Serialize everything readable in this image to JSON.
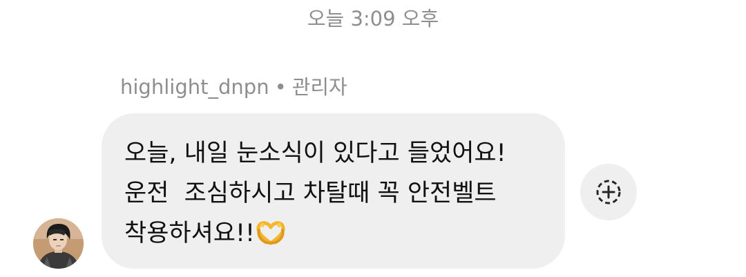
{
  "timestamp": "오늘 3:09 오후",
  "sender": {
    "username": "highlight_dnpn",
    "separator": "•",
    "role": "관리자"
  },
  "message": {
    "lines": [
      "오늘, 내일 눈소식이 있다고 들었어요!",
      "운전  조심하시고 차탈때 꼭 안전벨트",
      "착용하셔요!!"
    ],
    "emoji": "heart-hands-emoji"
  },
  "react_button": {
    "icon": "add-reaction-icon"
  },
  "colors": {
    "bubble": "#efefef",
    "meta_text": "#8e8e8e",
    "message_text": "#111111"
  }
}
